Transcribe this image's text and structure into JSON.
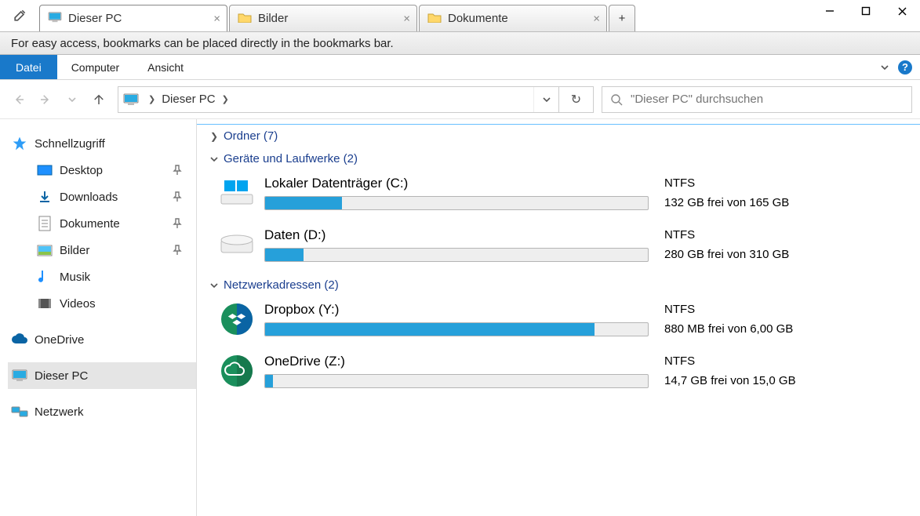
{
  "tabs": [
    {
      "label": "Dieser PC",
      "type": "pc",
      "active": true
    },
    {
      "label": "Bilder",
      "type": "folder",
      "active": false
    },
    {
      "label": "Dokumente",
      "type": "folder",
      "active": false
    }
  ],
  "bookmarks_hint": "For easy access, bookmarks can be placed directly in the bookmarks bar.",
  "menu": {
    "file": "Datei",
    "computer": "Computer",
    "view": "Ansicht"
  },
  "breadcrumb": {
    "root": "Dieser PC"
  },
  "search": {
    "placeholder": "\"Dieser PC\" durchsuchen"
  },
  "sidebar": {
    "quick_access": "Schnellzugriff",
    "quick_items": [
      {
        "key": "desktop",
        "label": "Desktop"
      },
      {
        "key": "downloads",
        "label": "Downloads"
      },
      {
        "key": "documents",
        "label": "Dokumente"
      },
      {
        "key": "pictures",
        "label": "Bilder"
      },
      {
        "key": "music",
        "label": "Musik"
      },
      {
        "key": "videos",
        "label": "Videos"
      }
    ],
    "onedrive": "OneDrive",
    "this_pc": "Dieser PC",
    "network": "Netzwerk"
  },
  "sections": {
    "folders": {
      "label": "Ordner",
      "count": "(7)",
      "expanded": false
    },
    "drives": {
      "label": "Geräte und Laufwerke",
      "count": "(2)",
      "expanded": true
    },
    "network": {
      "label": "Netzwerkadressen",
      "count": "(2)",
      "expanded": true
    }
  },
  "drives": [
    {
      "key": "local-c",
      "name": "Lokaler Datenträger (C:)",
      "fs": "NTFS",
      "free": "132 GB frei von 165 GB",
      "fill": 20,
      "icon": "windows-drive"
    },
    {
      "key": "data-d",
      "name": "Daten (D:)",
      "fs": "NTFS",
      "free": "280 GB frei von 310 GB",
      "fill": 10,
      "icon": "drive"
    }
  ],
  "netlocs": [
    {
      "key": "dropbox-y",
      "name": "Dropbox (Y:)",
      "fs": "NTFS",
      "free": "880 MB frei von 6,00 GB",
      "fill": 86,
      "icon": "dropbox"
    },
    {
      "key": "onedrive-z",
      "name": "OneDrive (Z:)",
      "fs": "NTFS",
      "free": "14,7 GB frei von 15,0 GB",
      "fill": 2,
      "icon": "onedrive-green"
    }
  ]
}
